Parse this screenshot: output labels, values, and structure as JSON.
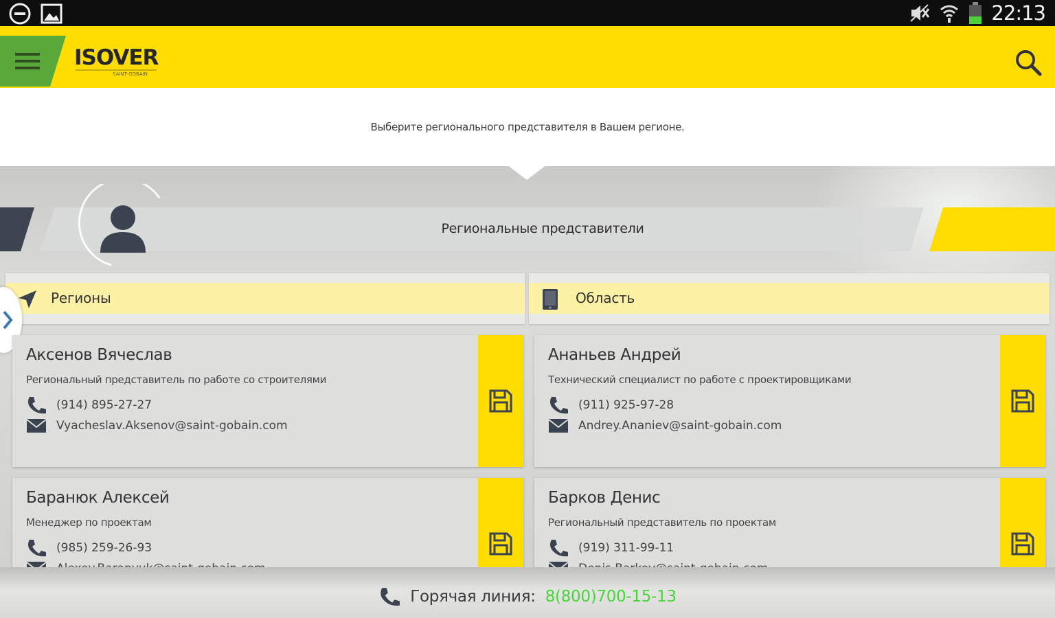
{
  "status_bar": {
    "clock": "22:13"
  },
  "app_bar": {
    "logo_text": "ISOVER",
    "logo_sub": "SAINT-GOBAIN"
  },
  "prompt": "Выберите регионального представителя в Вашем регионе.",
  "section_title": "Региональные представители",
  "filters": {
    "regions_label": "Регионы",
    "area_label": "Область"
  },
  "contacts": [
    {
      "name": "Аксенов Вячеслав",
      "role": "Региональный представитель по работе со строителями",
      "phone": "(914) 895-27-27",
      "email": "Vyacheslav.Aksenov@saint-gobain.com"
    },
    {
      "name": "Ананьев Андрей",
      "role": "Технический специалист по работе с проектировщиками",
      "phone": "(911) 925-97-28",
      "email": "Andrey.Ananiev@saint-gobain.com"
    },
    {
      "name": "Баранюк Алексей",
      "role": "Менеджер по проектам",
      "phone": "(985) 259-26-93",
      "email": "Alexey.Baranyuk@saint-gobain.com"
    },
    {
      "name": "Барков Денис",
      "role": "Региональный представитель по проектам",
      "phone": "(919) 311-99-11",
      "email": "Denis.Barkov@saint-gobain.com"
    }
  ],
  "footer": {
    "hotline_label": "Горячая линия:",
    "hotline_number": "8(800)700-15-13"
  },
  "colors": {
    "brand_yellow": "#ffdd00",
    "menu_green": "#5aa73a",
    "hotline_green": "#49d43a"
  }
}
